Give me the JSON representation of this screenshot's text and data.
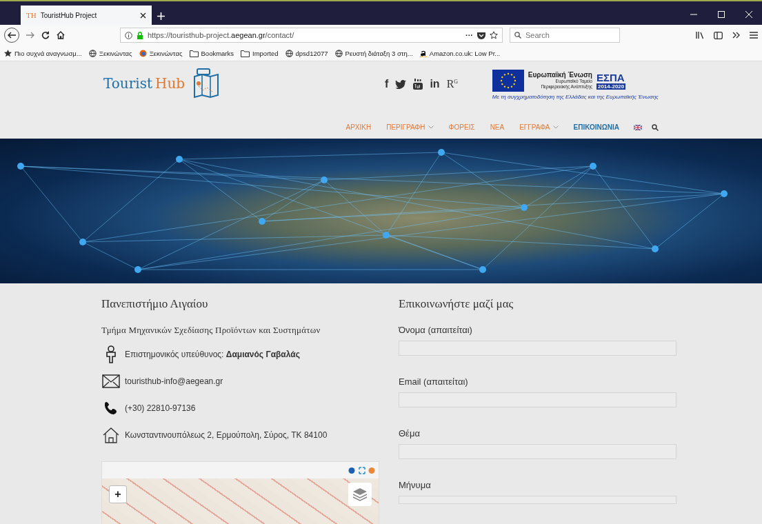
{
  "browser": {
    "tab": {
      "favicon": "TH",
      "title": "TouristHub Project",
      "selected": true
    },
    "url": "https://touristhub-project.**aegean.gr**/contact/",
    "page_actions": "···",
    "search": {
      "placeholder": "Search"
    },
    "bookmarks": [
      {
        "kind": "star",
        "label": "Πιο συχνά αναγνωσμ..."
      },
      {
        "kind": "globe",
        "label": "Ξεκινώντας"
      },
      {
        "kind": "firefox",
        "label": "Ξεκινώντας"
      },
      {
        "kind": "folder",
        "label": "Bookmarks"
      },
      {
        "kind": "folder",
        "label": "Imported"
      },
      {
        "kind": "globe",
        "label": "dpsd12077"
      },
      {
        "kind": "globe",
        "label": "Ρευστή διάταξη 3 στη..."
      },
      {
        "kind": "amazon",
        "label": "Amazon.co.uk: Low Pr..."
      }
    ]
  },
  "header": {
    "logo": {
      "first": "Tourist",
      "second": "Hub"
    },
    "social": [
      {
        "kind": "text",
        "label": "f"
      },
      {
        "kind": "bird"
      },
      {
        "kind": "tube"
      },
      {
        "kind": "text",
        "label": "in"
      },
      {
        "kind": "text",
        "label": "R$^{G}$"
      }
    ],
    "eu_banner": {
      "union": "Ευρωπαϊκή Ένωση",
      "fund": "Ευρωπαϊκό Ταμείο",
      "fund_2": "Περιφερειακής Ανάπτυξης",
      "espa": "ΕΣΠΑ",
      "years": "2014-2020",
      "caption": "Με τη συγχρηματοδότηση της Ελλάδας και της Ευρωπαϊκής Ένωσης"
    }
  },
  "nav": [
    {
      "label": "ΑΡΧΙΚΗ",
      "dropdown": false,
      "selected": false
    },
    {
      "label": "ΠΕΡΙΓΡΑΦΗ",
      "dropdown": true,
      "selected": false
    },
    {
      "label": "ΦΟΡΕΙΣ",
      "dropdown": false,
      "selected": false
    },
    {
      "label": "ΝΕΑ",
      "dropdown": false,
      "selected": false
    },
    {
      "label": "ΕΓΓΡΑΦΑ",
      "dropdown": true,
      "selected": false
    },
    {
      "label": "ΕΠΙΚΟΙΝΩΝΙΑ",
      "dropdown": false,
      "selected": true
    }
  ],
  "contact": {
    "title": "Πανεπιστήμιο Αιγαίου",
    "department": "Τμήμα Μηχανικών Σχεδίασης Προϊόντων και Συστημάτων",
    "items": [
      {
        "kind": "person",
        "text": "Επιστημονικός υπεύθυνος: **Δαμιανός Γαβαλάς**"
      },
      {
        "kind": "mail",
        "text": "touristhub-info@aegean.gr"
      },
      {
        "kind": "phone",
        "text": "(+30) 22810-97136"
      },
      {
        "kind": "home",
        "text": "Κωνσταντινουπόλεως 2, Ερμούπολη, Σύρος, ΤΚ 84100"
      }
    ],
    "map": {
      "zoom_in": "+"
    }
  },
  "form": {
    "title": "Επικοινωνήστε μαζί μας",
    "fields": [
      {
        "label": "Όνομα (απαιτείται)",
        "kind": "input"
      },
      {
        "label": "Email (απαιτείται)",
        "kind": "input"
      },
      {
        "label": "Θέμα",
        "kind": "input"
      },
      {
        "label": "Μήνυμα",
        "kind": "textarea"
      }
    ]
  }
}
